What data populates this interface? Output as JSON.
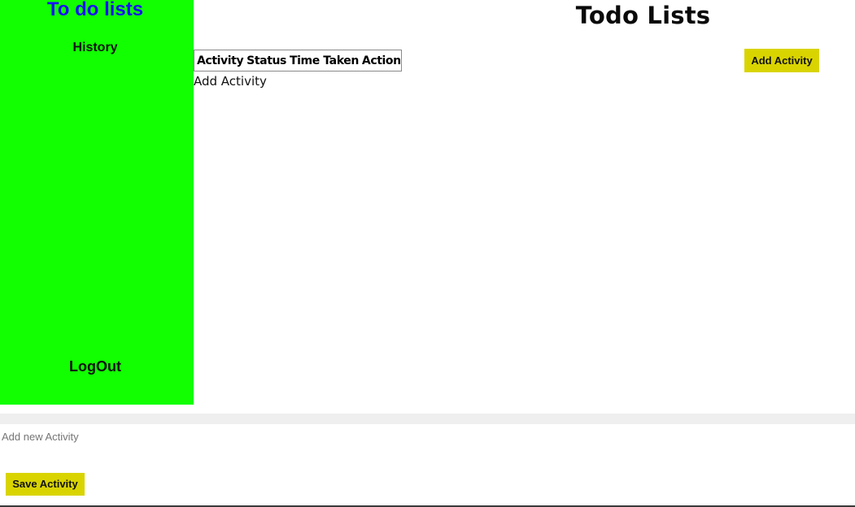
{
  "sidebar": {
    "title": "To do lists",
    "history_label": "History",
    "logout_label": "LogOut"
  },
  "main": {
    "title": "Todo Lists",
    "table": {
      "columns": [
        "Activity",
        "Status",
        "Time Taken",
        "Action"
      ]
    },
    "add_activity_text": "Add Activity",
    "add_activity_button": "Add Activity"
  },
  "form": {
    "input_placeholder": "Add new Activity",
    "input_value": "",
    "save_button": "Save Activity"
  },
  "colors": {
    "sidebar_bg": "#11ff00",
    "sidebar_title": "#1a0ff5",
    "button_bg": "#d9d400"
  }
}
